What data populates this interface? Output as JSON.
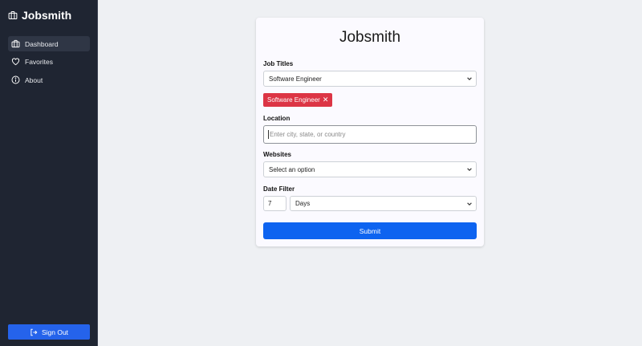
{
  "sidebar": {
    "brand": {
      "name": "Jobsmith",
      "icon": "briefcase-icon"
    },
    "items": [
      {
        "label": "Dashboard",
        "icon": "briefcase-icon",
        "active": true
      },
      {
        "label": "Favorites",
        "icon": "heart-icon",
        "active": false
      },
      {
        "label": "About",
        "icon": "info-icon",
        "active": false
      }
    ],
    "sign_out": {
      "label": "Sign Out",
      "icon": "sign-out-icon"
    }
  },
  "form": {
    "title": "Jobsmith",
    "job_titles": {
      "label": "Job Titles",
      "selected": "Software Engineer",
      "tags": [
        {
          "label": "Software Engineer",
          "remove_icon": "close-icon"
        }
      ]
    },
    "location": {
      "label": "Location",
      "placeholder": "Enter city, state, or country",
      "value": ""
    },
    "websites": {
      "label": "Websites",
      "selected": "Select an option"
    },
    "date_filter": {
      "label": "Date Filter",
      "amount": "7",
      "unit": "Days"
    },
    "submit_label": "Submit"
  },
  "colors": {
    "sidebar_bg": "#1f2532",
    "page_bg": "#eef0f3",
    "primary": "#0d63f0",
    "sign_out_bg": "#2563eb",
    "tag_bg": "#dc3545"
  }
}
